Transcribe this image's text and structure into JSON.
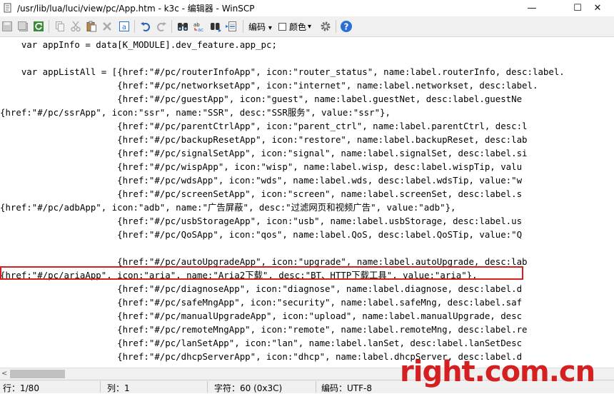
{
  "window": {
    "title": "/usr/lib/lua/luci/view/pc/App.htm - k3c - 编辑器 - WinSCP",
    "minimize_glyph": "—",
    "maximize_glyph": "☐",
    "close_glyph": "✕"
  },
  "toolbar": {
    "encoding_label": "编码",
    "color_label": "颜色",
    "dropdown_glyph": "▾"
  },
  "editor": {
    "lines": [
      "    var appInfo = data[K_MODULE].dev_feature.app_pc;",
      "",
      "    var appListAll = [{href:\"#/pc/routerInfoApp\", icon:\"router_status\", name:label.routerInfo, desc:label.",
      "                      {href:\"#/pc/networksetApp\", icon:\"internet\", name:label.networkset, desc:label.",
      "                      {href:\"#/pc/guestApp\", icon:\"guest\", name:label.guestNet, desc:label.guestNe",
      "{href:\"#/pc/ssrApp\", icon:\"ssr\", name:\"SSR\", desc:\"SSR服务\", value:\"ssr\"},",
      "                      {href:\"#/pc/parentCtrlApp\", icon:\"parent_ctrl\", name:label.parentCtrl, desc:l",
      "                      {href:\"#/pc/backupResetApp\", icon:\"restore\", name:label.backupReset, desc:lab",
      "                      {href:\"#/pc/signalSetApp\", icon:\"signal\", name:label.signalSet, desc:label.si",
      "                      {href:\"#/pc/wispApp\", icon:\"wisp\", name:label.wisp, desc:label.wispTip, valu",
      "                      {href:\"#/pc/wdsApp\", icon:\"wds\", name:label.wds, desc:label.wdsTip, value:\"w",
      "                      {href:\"#/pc/screenSetApp\", icon:\"screen\", name:label.screenSet, desc:label.s",
      "{href:\"#/pc/adbApp\", icon:\"adb\", name:\"广告屏蔽\", desc:\"过滤网页和视频广告\", value:\"adb\"},",
      "                      {href:\"#/pc/usbStorageApp\", icon:\"usb\", name:label.usbStorage, desc:label.us",
      "                      {href:\"#/pc/QoSApp\", icon:\"qos\", name:label.QoS, desc:label.QoSTip, value:\"Q",
      "",
      "                      {href:\"#/pc/autoUpgradeApp\", icon:\"upgrade\", name:label.autoUpgrade, desc:lab",
      "{href:\"#/pc/ariaApp\", icon:\"aria\", name:\"Aria2下载\", desc:\"BT、HTTP下载工具\", value:\"aria\"},",
      "                      {href:\"#/pc/diagnoseApp\", icon:\"diagnose\", name:label.diagnose, desc:label.d",
      "                      {href:\"#/pc/safeMngApp\", icon:\"security\", name:label.safeMng, desc:label.saf",
      "                      {href:\"#/pc/manualUpgradeApp\", icon:\"upload\", name:label.manualUpgrade, desc",
      "                      {href:\"#/pc/remoteMngApp\", icon:\"remote\", name:label.remoteMng, desc:label.re",
      "                      {href:\"#/pc/lanSetApp\", icon:\"lan\", name:label.lanSet, desc:label.lanSetDesc",
      "                      {href:\"#/pc/dhcpServerApp\", icon:\"dhcp\", name:label.dhcpServer, desc:label.d"
    ]
  },
  "scrollbar": {
    "left_arrow": "<"
  },
  "status": {
    "line": "行：1/80",
    "col": "列：1",
    "chars": "字符：60 (0x3C)",
    "encoding": "编码：UTF-8"
  },
  "watermark": "right.com.cn",
  "icons": {
    "save": "save-icon",
    "save_all": "save-all-icon",
    "reload": "reload-icon",
    "copy": "copy-icon",
    "cut": "cut-icon",
    "paste": "paste-icon",
    "delete": "delete-icon",
    "select_all": "select-all-icon",
    "undo": "undo-icon",
    "redo": "redo-icon",
    "find": "find-icon",
    "replace": "replace-icon",
    "find_next": "find-next-icon",
    "goto_line": "goto-line-icon",
    "settings": "gear-icon",
    "help": "help-icon"
  },
  "colors": {
    "highlight_border": "#d42020",
    "watermark": "#d42020",
    "help_blue": "#2a6fd6"
  }
}
